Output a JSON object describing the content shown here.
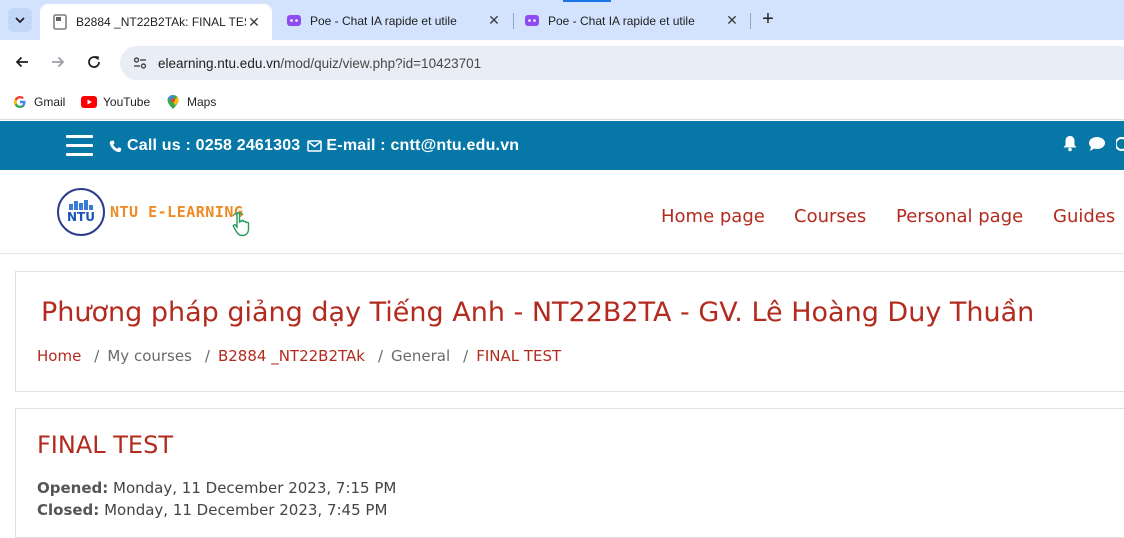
{
  "browser": {
    "tabs": [
      {
        "title": "B2884 _NT22B2TAk: FINAL TEST",
        "active": true,
        "favicon": "page-icon"
      },
      {
        "title": "Poe - Chat IA rapide et utile",
        "active": false,
        "favicon": "poe-icon"
      },
      {
        "title": "Poe - Chat IA rapide et utile",
        "active": false,
        "favicon": "poe-icon"
      }
    ],
    "new_tab": "+",
    "url_domain": "elearning.ntu.edu.vn",
    "url_path": "/mod/quiz/view.php?id=10423701",
    "bookmarks": [
      {
        "label": "Gmail",
        "icon": "google-icon"
      },
      {
        "label": "YouTube",
        "icon": "youtube-icon"
      },
      {
        "label": "Maps",
        "icon": "maps-icon"
      }
    ],
    "colors": {
      "tabstrip": "#d3e3fd",
      "omnibox": "#e9eef6"
    }
  },
  "site": {
    "topbar": {
      "call_label": "Call us : 0258 2461303",
      "email_label": "E-mail : cntt@ntu.edu.vn",
      "color": "#0777a8"
    },
    "logo": {
      "circle_text": "NTU",
      "text": "NTU E-LEARNING"
    },
    "nav": [
      "Home page",
      "Courses",
      "Personal page",
      "Guides"
    ],
    "accent_color": "#b32a1e"
  },
  "page": {
    "course_title": "Phương pháp giảng dạy Tiếng Anh - NT22B2TA - GV. Lê Hoàng Duy Thuần",
    "breadcrumb": [
      "Home",
      "My courses",
      "B2884 _NT22B2TAk",
      "General",
      "FINAL TEST"
    ],
    "quiz_title": "FINAL TEST",
    "opened_label": "Opened:",
    "opened_value": "Monday, 11 December 2023, 7:15 PM",
    "closed_label": "Closed:",
    "closed_value": "Monday, 11 December 2023, 7:45 PM"
  }
}
